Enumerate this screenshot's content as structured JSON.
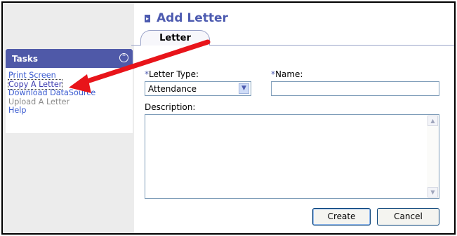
{
  "page": {
    "title": "Add Letter"
  },
  "tabs": [
    {
      "label": "Letter",
      "active": true
    }
  ],
  "sidebar": {
    "header": "Tasks",
    "items": [
      {
        "label": "Print Screen",
        "enabled": true
      },
      {
        "label": "Copy A Letter",
        "enabled": true,
        "focused": true
      },
      {
        "label": "Download DataSource",
        "enabled": true
      },
      {
        "label": "Upload A Letter",
        "enabled": false
      },
      {
        "label": "Help",
        "enabled": true
      }
    ]
  },
  "form": {
    "letter_type": {
      "required_mark": "*",
      "label": "Letter Type:",
      "value": "Attendance"
    },
    "name": {
      "required_mark": "*",
      "label": "Name:",
      "value": ""
    },
    "description": {
      "label": "Description:",
      "value": ""
    }
  },
  "buttons": {
    "create": "Create",
    "cancel": "Cancel"
  },
  "colors": {
    "accent": "#4d5bb0",
    "annotation_arrow": "#e8141a",
    "link": "#3a5bd0"
  }
}
